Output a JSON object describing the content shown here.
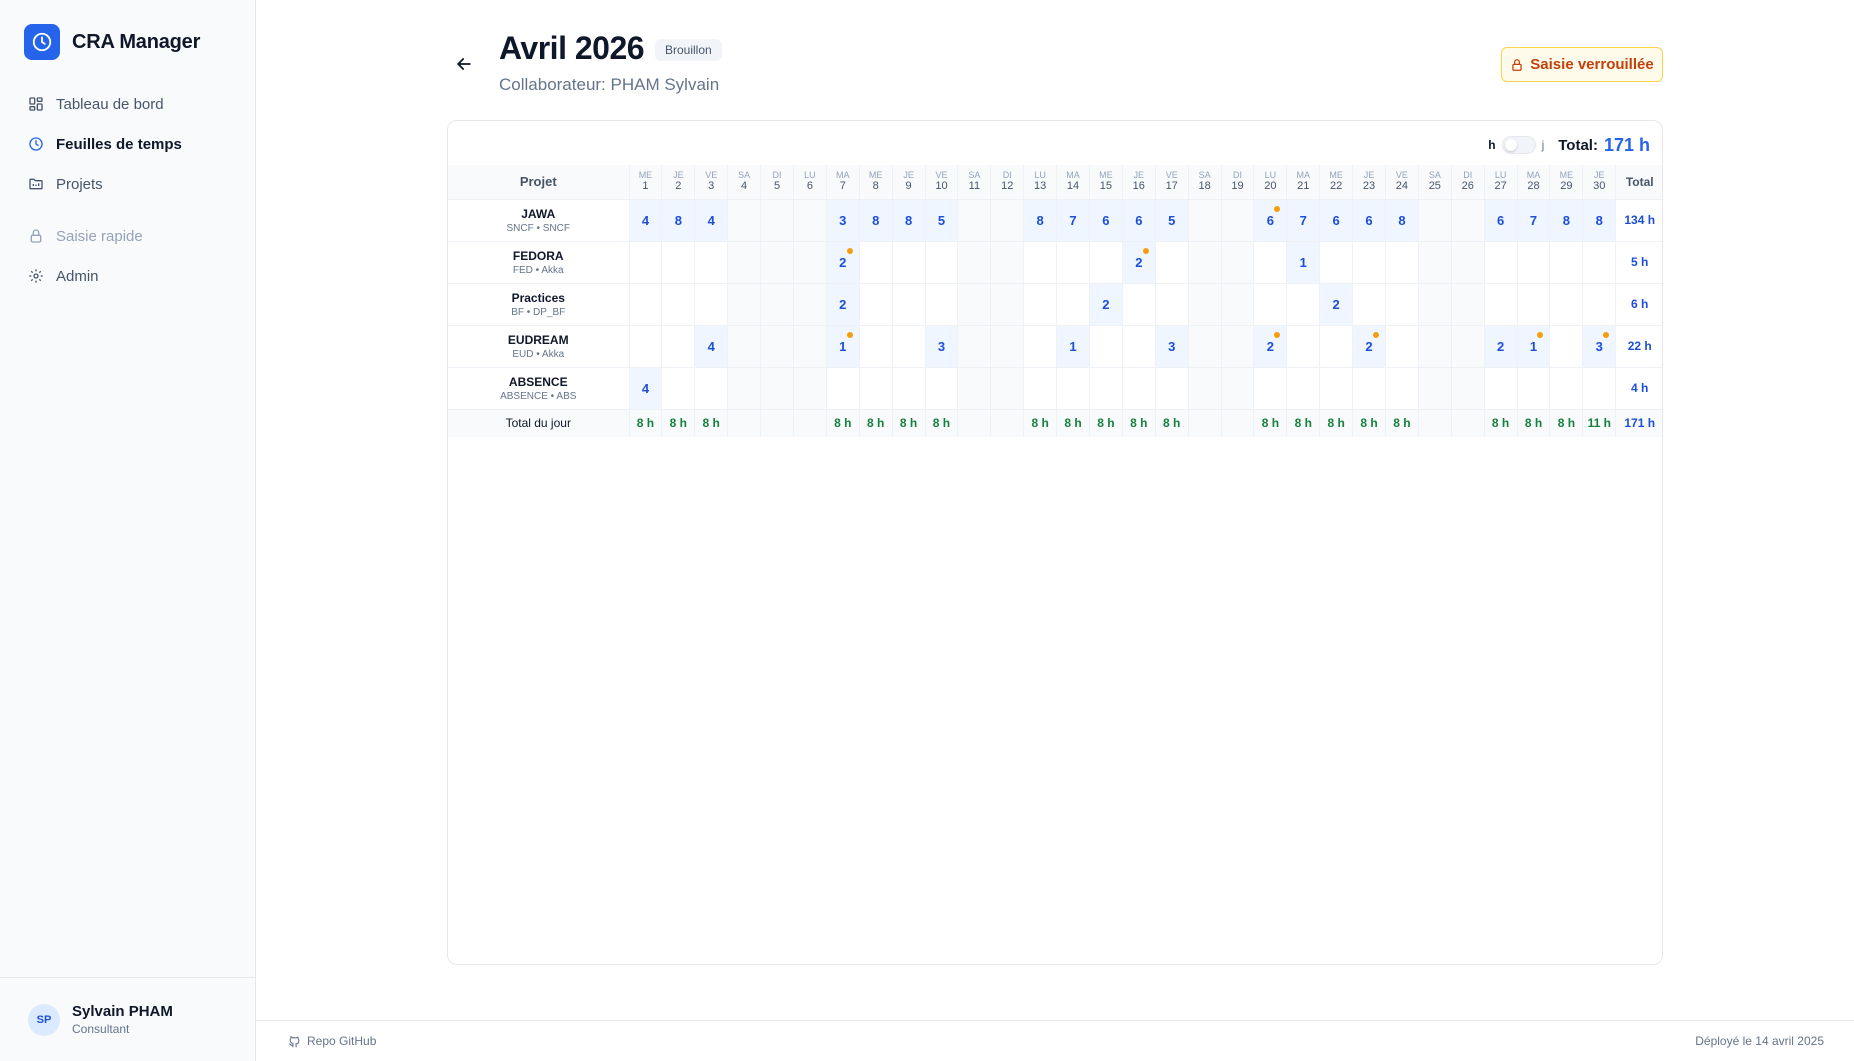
{
  "app": {
    "name": "CRA Manager",
    "logo_icon": "clock-icon",
    "accent": "#2563eb"
  },
  "nav": [
    {
      "label": "Tableau de bord",
      "icon": "dashboard-icon",
      "state": "normal"
    },
    {
      "label": "Feuilles de temps",
      "icon": "clock-icon",
      "state": "active"
    },
    {
      "label": "Projets",
      "icon": "folder-icon",
      "state": "normal"
    },
    {
      "label": "Saisie rapide",
      "icon": "lock-icon",
      "state": "muted"
    },
    {
      "label": "Admin",
      "icon": "gear-icon",
      "state": "normal"
    }
  ],
  "user": {
    "initials": "SP",
    "name": "Sylvain PHAM",
    "role": "Consultant"
  },
  "header": {
    "title": "Avril 2026",
    "status": "Brouillon",
    "subtitle": "Collaborateur: PHAM Sylvain",
    "locked_label": "Saisie verrouillée"
  },
  "toolbar": {
    "unit_h": "h",
    "unit_j": "j",
    "total_label": "Total:",
    "total_value": "171 h"
  },
  "table": {
    "project_header": "Projet",
    "total_header": "Total",
    "days": [
      {
        "dow": "ME",
        "num": "1"
      },
      {
        "dow": "JE",
        "num": "2"
      },
      {
        "dow": "VE",
        "num": "3"
      },
      {
        "dow": "SA",
        "num": "4",
        "weekend": true
      },
      {
        "dow": "DI",
        "num": "5",
        "weekend": true
      },
      {
        "dow": "LU",
        "num": "6",
        "weekend": true
      },
      {
        "dow": "MA",
        "num": "7"
      },
      {
        "dow": "ME",
        "num": "8"
      },
      {
        "dow": "JE",
        "num": "9"
      },
      {
        "dow": "VE",
        "num": "10"
      },
      {
        "dow": "SA",
        "num": "11",
        "weekend": true
      },
      {
        "dow": "DI",
        "num": "12",
        "weekend": true
      },
      {
        "dow": "LU",
        "num": "13"
      },
      {
        "dow": "MA",
        "num": "14"
      },
      {
        "dow": "ME",
        "num": "15"
      },
      {
        "dow": "JE",
        "num": "16"
      },
      {
        "dow": "VE",
        "num": "17"
      },
      {
        "dow": "SA",
        "num": "18",
        "weekend": true
      },
      {
        "dow": "DI",
        "num": "19",
        "weekend": true
      },
      {
        "dow": "LU",
        "num": "20"
      },
      {
        "dow": "MA",
        "num": "21"
      },
      {
        "dow": "ME",
        "num": "22"
      },
      {
        "dow": "JE",
        "num": "23"
      },
      {
        "dow": "VE",
        "num": "24"
      },
      {
        "dow": "SA",
        "num": "25",
        "weekend": true
      },
      {
        "dow": "DI",
        "num": "26",
        "weekend": true
      },
      {
        "dow": "LU",
        "num": "27"
      },
      {
        "dow": "MA",
        "num": "28"
      },
      {
        "dow": "ME",
        "num": "29"
      },
      {
        "dow": "JE",
        "num": "30"
      }
    ],
    "rows": [
      {
        "name": "JAWA",
        "sub": "SNCF • SNCF",
        "total": "134 h",
        "cells": [
          "4",
          "8",
          "4",
          "",
          "",
          "",
          "3",
          "8",
          "8",
          "5",
          "",
          "",
          "8",
          "7",
          "6",
          "6",
          "5",
          "",
          "",
          "6",
          "7",
          "6",
          "6",
          "8",
          "",
          "",
          "6",
          "7",
          "8",
          "8"
        ],
        "notes": [
          19
        ]
      },
      {
        "name": "FEDORA",
        "sub": "FED • Akka",
        "total": "5 h",
        "cells": [
          "",
          "",
          "",
          "",
          "",
          "",
          "2",
          "",
          "",
          "",
          "",
          "",
          "",
          "",
          "",
          "2",
          "",
          "",
          "",
          "",
          "1",
          "",
          "",
          "",
          "",
          "",
          "",
          "",
          "",
          ""
        ],
        "notes": [
          6,
          15
        ]
      },
      {
        "name": "Practices",
        "sub": "BF • DP_BF",
        "total": "6 h",
        "cells": [
          "",
          "",
          "",
          "",
          "",
          "",
          "2",
          "",
          "",
          "",
          "",
          "",
          "",
          "",
          "2",
          "",
          "",
          "",
          "",
          "",
          "",
          "2",
          "",
          "",
          "",
          "",
          "",
          "",
          "",
          ""
        ],
        "notes": []
      },
      {
        "name": "EUDREAM",
        "sub": "EUD • Akka",
        "total": "22 h",
        "cells": [
          "",
          "",
          "4",
          "",
          "",
          "",
          "1",
          "",
          "",
          "3",
          "",
          "",
          "",
          "1",
          "",
          "",
          "3",
          "",
          "",
          "2",
          "",
          "",
          "2",
          "",
          "",
          "",
          "2",
          "1",
          "",
          "3"
        ],
        "notes": [
          6,
          19,
          22,
          27,
          29
        ]
      },
      {
        "name": "ABSENCE",
        "sub": "ABSENCE • ABS",
        "total": "4 h",
        "cells": [
          "4",
          "",
          "",
          "",
          "",
          "",
          "",
          "",
          "",
          "",
          "",
          "",
          "",
          "",
          "",
          "",
          "",
          "",
          "",
          "",
          "",
          "",
          "",
          "",
          "",
          "",
          "",
          "",
          "",
          ""
        ],
        "notes": []
      }
    ],
    "day_total_label": "Total du jour",
    "day_totals": [
      "8 h",
      "8 h",
      "8 h",
      "",
      "",
      "",
      "8 h",
      "8 h",
      "8 h",
      "8 h",
      "",
      "",
      "8 h",
      "8 h",
      "8 h",
      "8 h",
      "8 h",
      "",
      "",
      "8 h",
      "8 h",
      "8 h",
      "8 h",
      "8 h",
      "",
      "",
      "8 h",
      "8 h",
      "8 h",
      "11 h"
    ],
    "grand_total": "171 h",
    "colors": {
      "value": "#1d4ed8",
      "day_total": "#15803d",
      "note_dot": "#f59e0b"
    }
  },
  "footer": {
    "repo_label": "Repo GitHub",
    "repo_icon": "github-icon",
    "deploy": "Déployé le 14 avril 2025"
  }
}
